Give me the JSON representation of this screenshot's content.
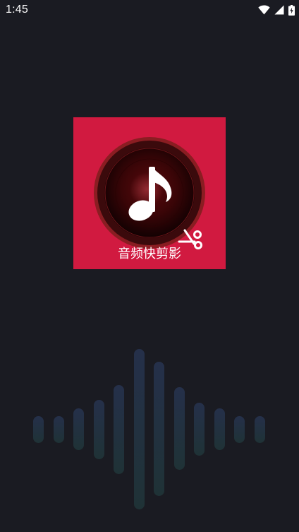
{
  "status_bar": {
    "time": "1:45",
    "icons": [
      "wifi-icon",
      "cellular-signal-icon",
      "battery-charging-icon"
    ]
  },
  "splash": {
    "app_name": "音频快剪影",
    "logo_background_color": "#d11a40",
    "logo_icons": [
      "music-note-icon",
      "scissors-icon"
    ]
  },
  "background_color": "#1a1b22",
  "waveform": {
    "bar_color": "#25304a",
    "levels": [
      0.17,
      0.17,
      0.26,
      0.37,
      0.56,
      1.0,
      0.84,
      0.52,
      0.33,
      0.26,
      0.17,
      0.17
    ]
  }
}
